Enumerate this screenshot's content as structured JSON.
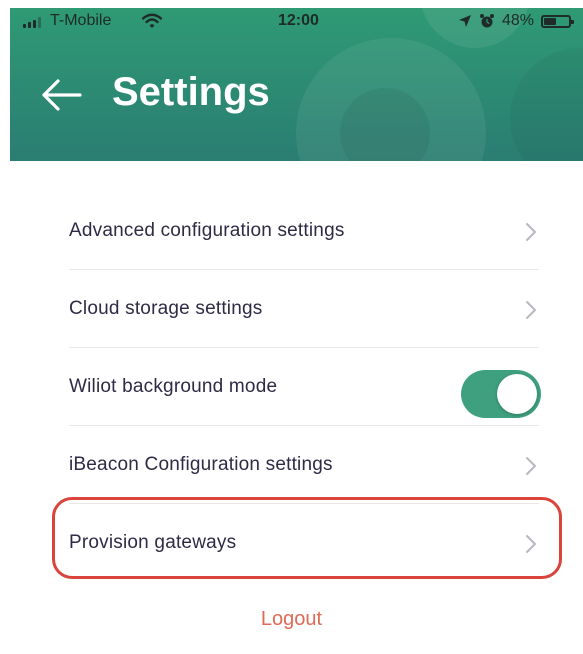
{
  "status_bar": {
    "carrier": "T-Mobile",
    "time": "12:00",
    "battery_percent": "48%",
    "battery_level": 0.48,
    "icons": [
      "signal-bars-icon",
      "wifi-icon",
      "location-arrow-icon",
      "alarm-icon",
      "battery-icon"
    ]
  },
  "header": {
    "title": "Settings",
    "back_icon": "arrow-left-icon"
  },
  "settings": {
    "items": [
      {
        "label": "Advanced configuration settings",
        "control": "chevron-right-icon"
      },
      {
        "label": "Cloud storage settings",
        "control": "chevron-right-icon"
      },
      {
        "label": "Wiliot background mode",
        "control": "toggle",
        "enabled": true
      },
      {
        "label": "iBeacon Configuration settings",
        "control": "chevron-right-icon"
      },
      {
        "label": "Provision gateways",
        "control": "chevron-right-icon",
        "highlighted": true
      }
    ]
  },
  "logout": {
    "label": "Logout"
  },
  "colors": {
    "header_green": "#2c8a73",
    "toggle_on": "#3ea07f",
    "text_primary": "#2f2a45",
    "logout_text": "#e06a55",
    "highlight_border": "#d9453c"
  }
}
